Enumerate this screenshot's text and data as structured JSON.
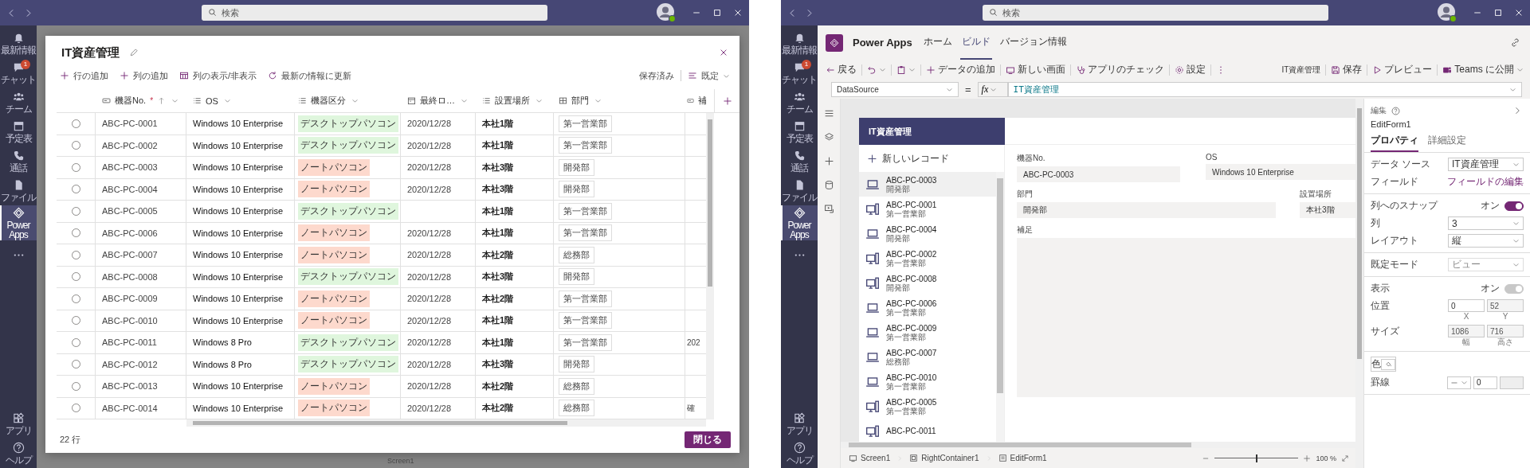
{
  "windows": [
    {
      "kind": "table_dialog",
      "title_bar": {
        "search": {
          "placeholder": "検索"
        }
      },
      "rail": {
        "items": [
          {
            "kind": "activity",
            "label": "最新情報",
            "selected": false
          },
          {
            "kind": "chat",
            "label": "チャット",
            "badge": "1",
            "selected": false
          },
          {
            "kind": "teams",
            "label": "チーム",
            "selected": false
          },
          {
            "kind": "calendar",
            "label": "予定表",
            "selected": false
          },
          {
            "kind": "calls",
            "label": "通話",
            "selected": false
          },
          {
            "kind": "files",
            "label": "ファイル",
            "selected": false
          },
          {
            "kind": "powerapps",
            "label": "Power Apps",
            "selected": true
          },
          {
            "kind": "more",
            "selected": false
          }
        ],
        "bottom_items": [
          {
            "kind": "apps",
            "label": "アプリ",
            "selected": false
          },
          {
            "kind": "help",
            "label": "ヘルプ",
            "selected": false
          }
        ]
      },
      "background": {
        "status_text": "Screen1"
      },
      "dialog": {
        "title": "IT資産管理",
        "toolbar": [
          {
            "kind": "add",
            "label": "行の追加"
          },
          {
            "kind": "add",
            "label": "列の追加"
          },
          {
            "kind": "columns",
            "label": "列の表示/非表示"
          },
          {
            "kind": "refresh",
            "label": "最新の情報に更新"
          }
        ],
        "save_state": "保存済み",
        "view": "既定",
        "table": {
          "columns": [
            {
              "kind": "text",
              "label": "機器No.",
              "required_mark": "*",
              "sorted": true
            },
            {
              "kind": "choice",
              "label": "OS"
            },
            {
              "kind": "choice",
              "label": "機器区分"
            },
            {
              "kind": "date",
              "label": "最終ロ…"
            },
            {
              "kind": "choice",
              "label": "設置場所"
            },
            {
              "kind": "lookup",
              "label": "部門"
            },
            {
              "kind": "text",
              "label": "補"
            }
          ],
          "rows": [
            {
              "selected": false,
              "no": "ABC-PC-0001",
              "os": "Windows 10 Enterprise",
              "category": {
                "label": "デスクトップパソコン",
                "color": "#dff6dd"
              },
              "last_login": "2020/12/28",
              "location": "本社1階",
              "department": "第一営業部"
            },
            {
              "selected": false,
              "no": "ABC-PC-0002",
              "os": "Windows 10 Enterprise",
              "category": {
                "label": "デスクトップパソコン",
                "color": "#dff6dd"
              },
              "last_login": "2020/12/28",
              "location": "本社1階",
              "department": "第一営業部"
            },
            {
              "selected": false,
              "no": "ABC-PC-0003",
              "os": "Windows 10 Enterprise",
              "category": {
                "label": "ノートパソコン",
                "color": "#fdd9cd"
              },
              "last_login": "2020/12/28",
              "location": "本社3階",
              "department": "開発部"
            },
            {
              "selected": false,
              "no": "ABC-PC-0004",
              "os": "Windows 10 Enterprise",
              "category": {
                "label": "ノートパソコン",
                "color": "#fdd9cd"
              },
              "last_login": "2020/12/28",
              "location": "本社3階",
              "department": "開発部"
            },
            {
              "selected": false,
              "no": "ABC-PC-0005",
              "os": "Windows 10 Enterprise",
              "category": {
                "label": "デスクトップパソコン",
                "color": "#dff6dd"
              },
              "location": "本社1階",
              "department": "第一営業部"
            },
            {
              "selected": false,
              "no": "ABC-PC-0006",
              "os": "Windows 10 Enterprise",
              "category": {
                "label": "ノートパソコン",
                "color": "#fdd9cd"
              },
              "last_login": "2020/12/28",
              "location": "本社1階",
              "department": "第一営業部"
            },
            {
              "selected": false,
              "no": "ABC-PC-0007",
              "os": "Windows 10 Enterprise",
              "category": {
                "label": "ノートパソコン",
                "color": "#fdd9cd"
              },
              "last_login": "2020/12/28",
              "location": "本社2階",
              "department": "総務部"
            },
            {
              "selected": false,
              "no": "ABC-PC-0008",
              "os": "Windows 10 Enterprise",
              "category": {
                "label": "デスクトップパソコン",
                "color": "#dff6dd"
              },
              "last_login": "2020/12/28",
              "location": "本社3階",
              "department": "開発部"
            },
            {
              "selected": false,
              "no": "ABC-PC-0009",
              "os": "Windows 10 Enterprise",
              "category": {
                "label": "ノートパソコン",
                "color": "#fdd9cd"
              },
              "last_login": "2020/12/28",
              "location": "本社2階",
              "department": "第一営業部"
            },
            {
              "selected": false,
              "no": "ABC-PC-0010",
              "os": "Windows 10 Enterprise",
              "category": {
                "label": "ノートパソコン",
                "color": "#fdd9cd"
              },
              "last_login": "2020/12/28",
              "location": "本社1階",
              "department": "第一営業部"
            },
            {
              "selected": false,
              "no": "ABC-PC-0011",
              "os": "Windows 8 Pro",
              "category": {
                "label": "デスクトップパソコン",
                "color": "#dff6dd"
              },
              "last_login": "2020/12/28",
              "location": "本社1階",
              "department": "第一営業部",
              "column_7": "202"
            },
            {
              "selected": false,
              "no": "ABC-PC-0012",
              "os": "Windows 8 Pro",
              "category": {
                "label": "デスクトップパソコン",
                "color": "#dff6dd"
              },
              "last_login": "2020/12/28",
              "location": "本社3階",
              "department": "開発部"
            },
            {
              "selected": false,
              "no": "ABC-PC-0013",
              "os": "Windows 10 Enterprise",
              "category": {
                "label": "ノートパソコン",
                "color": "#fdd9cd"
              },
              "last_login": "2020/12/28",
              "location": "本社2階",
              "department": "総務部"
            },
            {
              "selected": false,
              "no": "ABC-PC-0014",
              "os": "Windows 10 Enterprise",
              "category": {
                "label": "ノートパソコン",
                "color": "#fdd9cd"
              },
              "last_login": "2020/12/28",
              "location": "本社2階",
              "department": "総務部",
              "column_7": "確"
            }
          ]
        },
        "row_count": "22 行",
        "close_button": "閉じる"
      }
    },
    {
      "kind": "studio",
      "title_bar": {
        "search": {
          "placeholder": "検索"
        }
      },
      "rail": {
        "items": [
          {
            "kind": "activity",
            "label": "最新情報",
            "selected": false
          },
          {
            "kind": "chat",
            "label": "チャット",
            "badge": "1",
            "selected": false
          },
          {
            "kind": "teams",
            "label": "チーム",
            "selected": false
          },
          {
            "kind": "calendar",
            "label": "予定表",
            "selected": false
          },
          {
            "kind": "calls",
            "label": "通話",
            "selected": false
          },
          {
            "kind": "files",
            "label": "ファイル",
            "selected": false
          },
          {
            "kind": "powerapps",
            "label": "Power Apps",
            "selected": true
          },
          {
            "kind": "more",
            "selected": false
          }
        ],
        "bottom_items": [
          {
            "kind": "apps",
            "label": "アプリ",
            "selected": false
          },
          {
            "kind": "help",
            "label": "ヘルプ",
            "selected": false
          }
        ]
      },
      "app_bar": {
        "name": "Power Apps",
        "tabs": [
          {
            "label": "ホーム",
            "selected": false
          },
          {
            "label": "ビルド",
            "selected": true
          },
          {
            "label": "バージョン情報",
            "selected": false
          }
        ]
      },
      "command_bar": {
        "left": [
          {
            "kind": "back",
            "label": "戻る"
          },
          {
            "kind": "undo",
            "menu": true
          },
          {
            "kind": "paste",
            "menu": true
          },
          {
            "kind": "add",
            "label": "データの追加"
          },
          {
            "kind": "screen",
            "label": "新しい画面"
          },
          {
            "kind": "checker",
            "label": "アプリのチェック"
          },
          {
            "kind": "settings",
            "label": "設定"
          },
          {
            "kind": "more"
          }
        ],
        "app_name": "IT資産管理",
        "right": [
          {
            "kind": "save",
            "label": "保存"
          },
          {
            "kind": "preview",
            "label": "プレビュー"
          },
          {
            "kind": "publish",
            "label": "Teams に公開",
            "menu": true
          }
        ]
      },
      "formula_bar": {
        "property": "DataSource",
        "equals": "=",
        "function_label": "fx",
        "formula": "IT資産管理"
      },
      "canvas": {
        "app_title": "IT資産管理",
        "new_record": "新しいレコード",
        "gallery": [
          {
            "kind": "laptop",
            "title": "ABC-PC-0003",
            "subtitle": "開発部",
            "selected": true
          },
          {
            "kind": "desktop",
            "title": "ABC-PC-0001",
            "subtitle": "第一営業部",
            "selected": false
          },
          {
            "kind": "laptop",
            "title": "ABC-PC-0004",
            "subtitle": "開発部",
            "selected": false
          },
          {
            "kind": "desktop",
            "title": "ABC-PC-0002",
            "subtitle": "第一営業部",
            "selected": false
          },
          {
            "kind": "desktop",
            "title": "ABC-PC-0008",
            "subtitle": "開発部",
            "selected": false
          },
          {
            "kind": "laptop",
            "title": "ABC-PC-0006",
            "subtitle": "第一営業部",
            "selected": false
          },
          {
            "kind": "laptop",
            "title": "ABC-PC-0009",
            "subtitle": "第一営業部",
            "selected": false
          },
          {
            "kind": "laptop",
            "title": "ABC-PC-0007",
            "subtitle": "総務部",
            "selected": false
          },
          {
            "kind": "laptop",
            "title": "ABC-PC-0010",
            "subtitle": "第一営業部",
            "selected": false
          },
          {
            "kind": "desktop",
            "title": "ABC-PC-0005",
            "subtitle": "第一営業部",
            "selected": false
          },
          {
            "kind": "desktop",
            "title": "ABC-PC-0011",
            "selected": false
          }
        ],
        "form": {
          "fields": [
            {
              "label": "機器No.",
              "value": "ABC-PC-0003"
            },
            {
              "label": "OS",
              "value": "Windows 10 Enterprise"
            },
            {
              "label": "部門",
              "value": "開発部"
            },
            {
              "label": "設置場所",
              "value": "本社3階"
            },
            {
              "label": "補足"
            }
          ]
        }
      },
      "status_bar": {
        "breadcrumbs": [
          {
            "kind": "screen",
            "label": "Screen1"
          },
          {
            "kind": "container",
            "label": "RightContainer1"
          },
          {
            "kind": "form",
            "label": "EditForm1"
          }
        ],
        "zoom": {
          "level": 0.5,
          "reading": "100 %"
        }
      },
      "properties": {
        "section": "編集",
        "control": "EditForm1",
        "tabs": [
          {
            "label": "プロパティ",
            "selected": true
          },
          {
            "label": "詳細設定",
            "selected": false
          }
        ],
        "groups": [
          {
            "rows": [
              {
                "kind": "dropdown",
                "label": "データ ソース",
                "value": "IT資産管理",
                "disabled": false
              },
              {
                "kind": "link",
                "label": "フィールド",
                "value": "フィールドの編集"
              }
            ]
          },
          {
            "rows": [
              {
                "kind": "toggle",
                "label": "列へのスナップ",
                "state_text": "オン",
                "on": true,
                "disabled": false
              },
              {
                "kind": "dropdown",
                "label": "列",
                "value": "3",
                "disabled": false
              },
              {
                "kind": "dropdown",
                "label": "レイアウト",
                "value": "縦",
                "disabled": false
              }
            ]
          },
          {
            "rows": [
              {
                "kind": "dropdown",
                "label": "既定モード",
                "value": "ビュー",
                "disabled": true
              }
            ]
          },
          {
            "rows": [
              {
                "kind": "toggle",
                "label": "表示",
                "state_text": "オン",
                "on": true,
                "disabled": true
              },
              {
                "kind": "pair",
                "label": "位置",
                "first": {
                  "value": "0",
                  "caption": "X",
                  "disabled": false
                },
                "second": {
                  "value": "52",
                  "caption": "Y",
                  "disabled": true
                }
              },
              {
                "kind": "pair",
                "label": "サイズ",
                "first": {
                  "value": "1086",
                  "caption": "幅",
                  "disabled": true
                },
                "second": {
                  "value": "716",
                  "caption": "高さ",
                  "disabled": true
                }
              }
            ]
          },
          {
            "rows": [
              {
                "kind": "color",
                "label": "色"
              },
              {
                "kind": "border",
                "label": "罫線",
                "value": "0"
              }
            ]
          }
        ]
      }
    }
  ]
}
